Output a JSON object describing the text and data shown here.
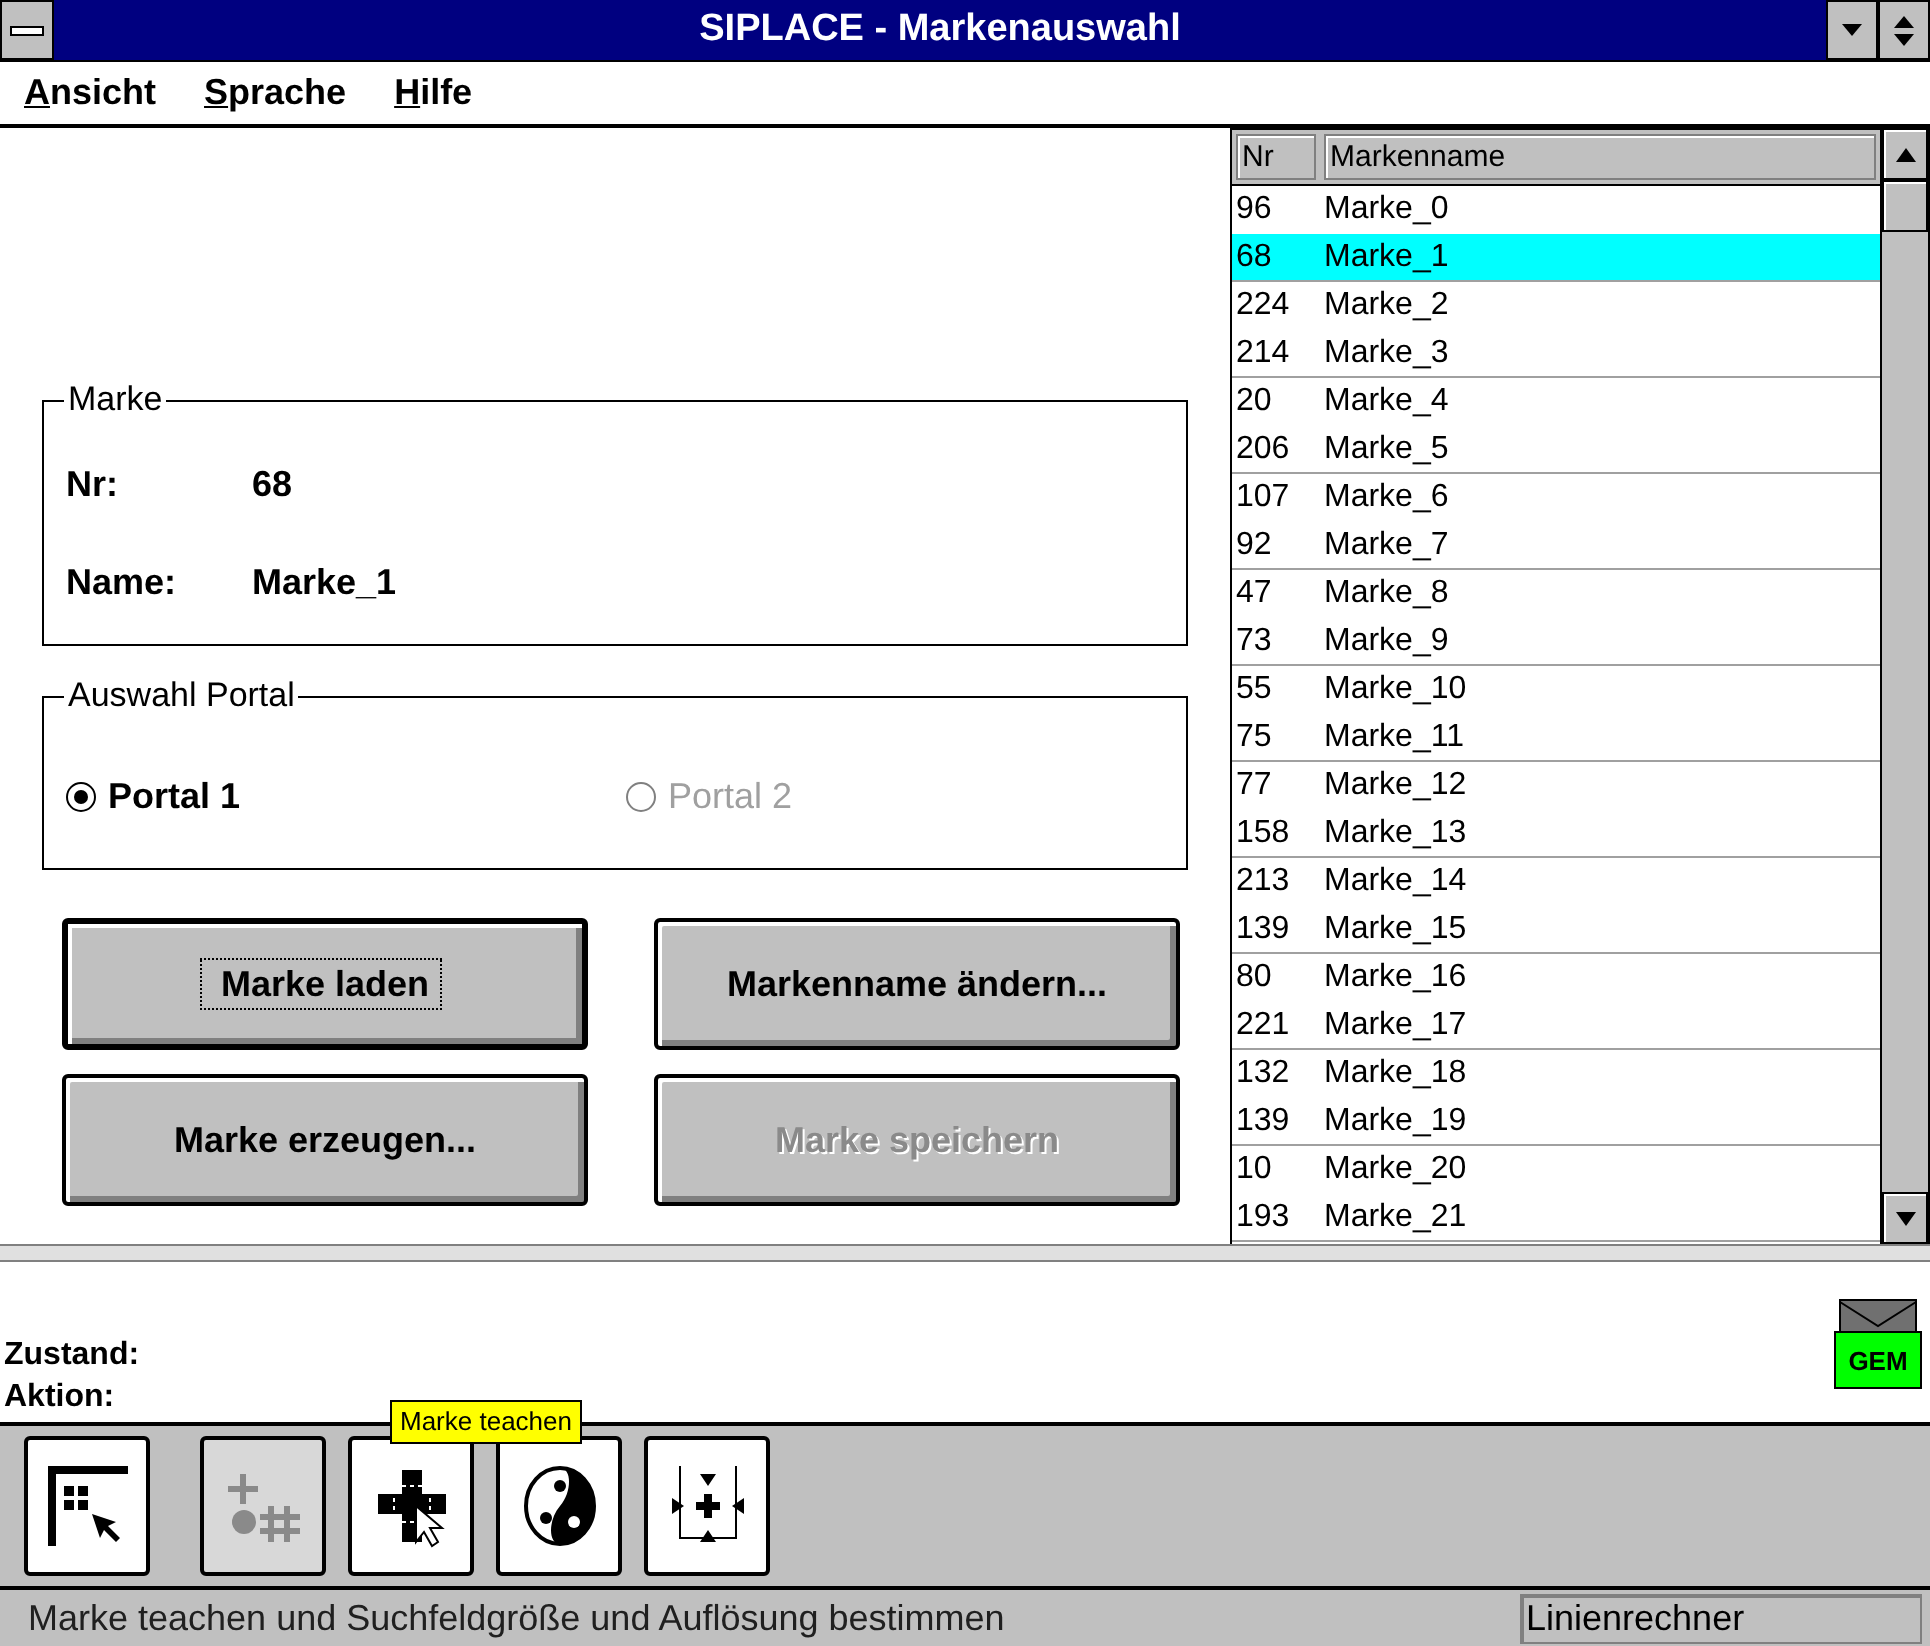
{
  "window": {
    "title": "SIPLACE - Markenauswahl"
  },
  "menu": [
    "Ansicht",
    "Sprache",
    "Hilfe"
  ],
  "marke": {
    "title": "Marke",
    "nr_label": "Nr:",
    "nr": "68",
    "name_label": "Name:",
    "name": "Marke_1"
  },
  "portal": {
    "title": "Auswahl Portal",
    "options": [
      {
        "label": "Portal 1",
        "selected": true,
        "disabled": false
      },
      {
        "label": "Portal 2",
        "selected": false,
        "disabled": true
      }
    ]
  },
  "buttons": [
    {
      "label": "Marke laden",
      "focused": true,
      "disabled": false
    },
    {
      "label": "Markenname ändern...",
      "focused": false,
      "disabled": false
    },
    {
      "label": "Marke erzeugen...",
      "focused": false,
      "disabled": false
    },
    {
      "label": "Marke speichern",
      "focused": false,
      "disabled": true
    }
  ],
  "table": {
    "columns": [
      "Nr",
      "Markenname"
    ],
    "rows": [
      {
        "nr": "96",
        "name": "Marke_0",
        "selected": false
      },
      {
        "nr": "68",
        "name": "Marke_1",
        "selected": true
      },
      {
        "nr": "224",
        "name": "Marke_2",
        "selected": false
      },
      {
        "nr": "214",
        "name": "Marke_3",
        "selected": false
      },
      {
        "nr": "20",
        "name": "Marke_4",
        "selected": false
      },
      {
        "nr": "206",
        "name": "Marke_5",
        "selected": false
      },
      {
        "nr": "107",
        "name": "Marke_6",
        "selected": false
      },
      {
        "nr": "92",
        "name": "Marke_7",
        "selected": false
      },
      {
        "nr": "47",
        "name": "Marke_8",
        "selected": false
      },
      {
        "nr": "73",
        "name": "Marke_9",
        "selected": false
      },
      {
        "nr": "55",
        "name": "Marke_10",
        "selected": false
      },
      {
        "nr": "75",
        "name": "Marke_11",
        "selected": false
      },
      {
        "nr": "77",
        "name": "Marke_12",
        "selected": false
      },
      {
        "nr": "158",
        "name": "Marke_13",
        "selected": false
      },
      {
        "nr": "213",
        "name": "Marke_14",
        "selected": false
      },
      {
        "nr": "139",
        "name": "Marke_15",
        "selected": false
      },
      {
        "nr": "80",
        "name": "Marke_16",
        "selected": false
      },
      {
        "nr": "221",
        "name": "Marke_17",
        "selected": false
      },
      {
        "nr": "132",
        "name": "Marke_18",
        "selected": false
      },
      {
        "nr": "139",
        "name": "Marke_19",
        "selected": false
      },
      {
        "nr": "10",
        "name": "Marke_20",
        "selected": false
      },
      {
        "nr": "193",
        "name": "Marke_21",
        "selected": false
      }
    ]
  },
  "status": {
    "zustand_label": "Zustand:",
    "aktion_label": "Aktion:",
    "mail_badge": "GEM"
  },
  "toolbar": {
    "tools": [
      {
        "kind": "select",
        "disabled": false
      },
      {
        "kind": "grid",
        "disabled": true
      },
      {
        "kind": "teach",
        "disabled": false
      },
      {
        "kind": "contrast",
        "disabled": false
      },
      {
        "kind": "center",
        "disabled": false
      }
    ],
    "tooltip": "Marke teachen"
  },
  "status_bar": {
    "message": "Marke teachen und Suchfeldgröße und Auflösung bestimmen",
    "panel": "Linienrechner"
  }
}
